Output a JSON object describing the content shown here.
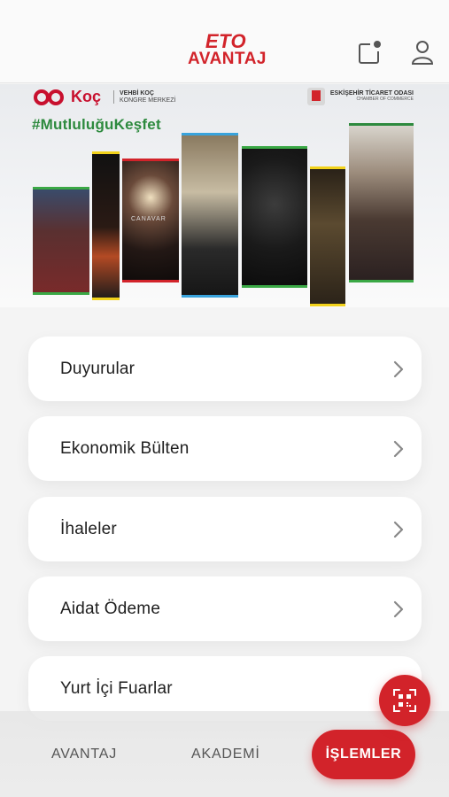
{
  "header": {
    "logo_top": "ETO",
    "logo_bottom": "AVANTAJ",
    "icons": [
      "notification-icon",
      "user-icon"
    ]
  },
  "banner": {
    "sponsor_brand": "Koç",
    "sponsor_line1": "VEHBİ KOÇ",
    "sponsor_line2": "KONGRE MERKEZİ",
    "org_line1": "ESKİŞEHİR TİCARET ODASI",
    "org_line2": "CHAMBER OF COMMERCE",
    "hashtag": "#MutluluğuKeşfet",
    "poster_text": "CANAVAR"
  },
  "menu": {
    "items": [
      {
        "label": "Duyurular"
      },
      {
        "label": "Ekonomik Bülten"
      },
      {
        "label": "İhaleler"
      },
      {
        "label": "Aidat Ödeme"
      },
      {
        "label": "Yurt İçi Fuarlar"
      }
    ]
  },
  "bottom_nav": {
    "items": [
      {
        "label": "AVANTAJ"
      },
      {
        "label": "AKADEMİ"
      },
      {
        "label": "İŞLEMLER",
        "active": true
      }
    ]
  },
  "qr_button": {
    "icon": "qr-code-icon"
  },
  "colors": {
    "brand_red": "#d2232a",
    "hashtag_green": "#2d8a3e"
  }
}
